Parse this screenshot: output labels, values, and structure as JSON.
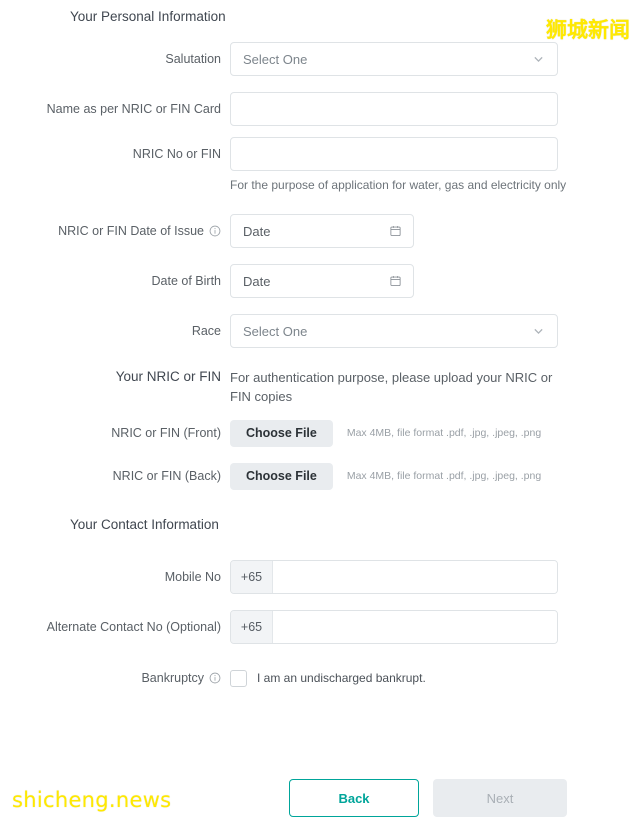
{
  "watermarks": {
    "brand_cn": "狮城新闻",
    "site": "shicheng.news",
    "color": "#ffe900"
  },
  "theme": {
    "accent": "#00a59a",
    "border": "#dfe3e6",
    "label_text": "#5a6066",
    "muted_text": "#9aa0a6",
    "disabled_bg": "#e9ecef"
  },
  "sections": {
    "personal": {
      "heading": "Your Personal Information"
    },
    "nric_upload": {
      "heading": "Your NRIC or FIN",
      "description": "For authentication purpose, please upload your NRIC or FIN copies"
    },
    "contact": {
      "heading": "Your Contact Information"
    }
  },
  "fields": {
    "salutation": {
      "label": "Salutation",
      "placeholder": "Select One",
      "value": "",
      "icon": "chevron-down-icon"
    },
    "name": {
      "label": "Name as per NRIC or FIN Card",
      "placeholder": "",
      "value": ""
    },
    "nric_no": {
      "label": "NRIC No or FIN",
      "placeholder": "",
      "value": "",
      "helper": "For the purpose of application for water, gas and electricity only"
    },
    "nric_issue_date": {
      "label": "NRIC or FIN Date of Issue",
      "placeholder": "Date",
      "value": "",
      "info": true,
      "icon": "calendar-icon"
    },
    "dob": {
      "label": "Date of Birth",
      "placeholder": "Date",
      "value": "",
      "info": false,
      "icon": "calendar-icon"
    },
    "race": {
      "label": "Race",
      "placeholder": "Select One",
      "value": "",
      "icon": "chevron-down-icon"
    },
    "nric_front": {
      "label": "NRIC or FIN (Front)",
      "button": "Choose File",
      "note": "Max 4MB, file format .pdf, .jpg, .jpeg, .png"
    },
    "nric_back": {
      "label": "NRIC or FIN (Back)",
      "button": "Choose File",
      "note": "Max 4MB, file format .pdf, .jpg, .jpeg, .png"
    },
    "mobile_no": {
      "label": "Mobile No",
      "prefix": "+65",
      "placeholder": "",
      "value": ""
    },
    "alt_contact_no": {
      "label": "Alternate Contact No (Optional)",
      "prefix": "+65",
      "placeholder": "",
      "value": ""
    },
    "bankruptcy": {
      "label": "Bankruptcy",
      "checkbox_label": "I am an undischarged bankrupt.",
      "checked": false,
      "info": true
    }
  },
  "footer": {
    "back_label": "Back",
    "next_label": "Next",
    "next_disabled": true
  }
}
